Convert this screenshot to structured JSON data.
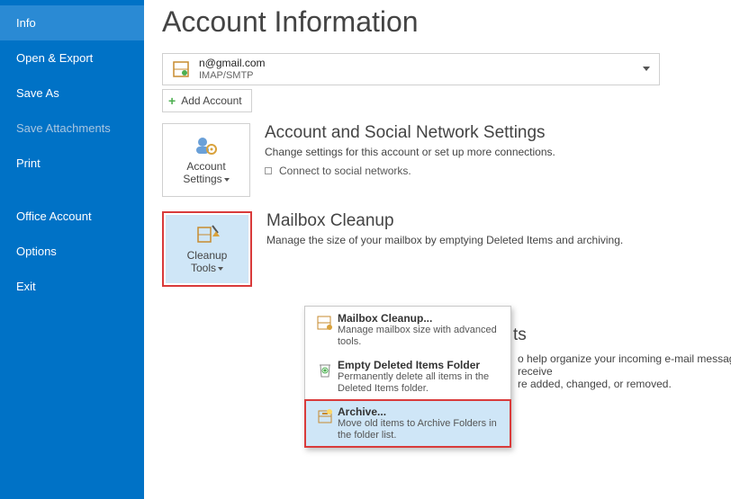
{
  "sidebar": {
    "items": [
      {
        "label": "Info",
        "selected": true,
        "disabled": false
      },
      {
        "label": "Open & Export",
        "selected": false,
        "disabled": false
      },
      {
        "label": "Save As",
        "selected": false,
        "disabled": false
      },
      {
        "label": "Save Attachments",
        "selected": false,
        "disabled": true
      },
      {
        "label": "Print",
        "selected": false,
        "disabled": false
      },
      {
        "label": "Office Account",
        "selected": false,
        "disabled": false,
        "gap": true
      },
      {
        "label": "Options",
        "selected": false,
        "disabled": false
      },
      {
        "label": "Exit",
        "selected": false,
        "disabled": false
      }
    ]
  },
  "header": {
    "title": "Account Information"
  },
  "account": {
    "email": "n@gmail.com",
    "protocol": "IMAP/SMTP",
    "add_label": "Add Account"
  },
  "sections": {
    "settings": {
      "tile_line1": "Account",
      "tile_line2": "Settings",
      "title": "Account and Social Network Settings",
      "desc": "Change settings for this account or set up more connections.",
      "connect": "Connect to social networks."
    },
    "cleanup": {
      "tile_line1": "Cleanup",
      "tile_line2": "Tools",
      "title": "Mailbox Cleanup",
      "desc": "Manage the size of your mailbox by emptying Deleted Items and archiving."
    },
    "rules_frag": {
      "title_frag": "ts",
      "line1": "o help organize your incoming e-mail messages, and receive",
      "line2": "re added, changed, or removed."
    }
  },
  "menu": {
    "items": [
      {
        "title": "Mailbox Cleanup...",
        "desc": "Manage mailbox size with advanced tools.",
        "icon": "cabinet-icon",
        "hl": false
      },
      {
        "title": "Empty Deleted Items Folder",
        "desc": "Permanently delete all items in the Deleted Items folder.",
        "icon": "trash-icon",
        "hl": false
      },
      {
        "title": "Archive...",
        "desc": "Move old items to Archive Folders in the folder list.",
        "icon": "archive-icon",
        "hl": true
      }
    ]
  },
  "icons": {
    "cabinet": "cabinet-icon",
    "settings": "gear-person-icon",
    "cleanup": "broom-cabinet-icon",
    "trash": "trash-icon",
    "archive": "archive-icon",
    "plus": "plus-icon",
    "dropdown": "chevron-down-icon"
  }
}
